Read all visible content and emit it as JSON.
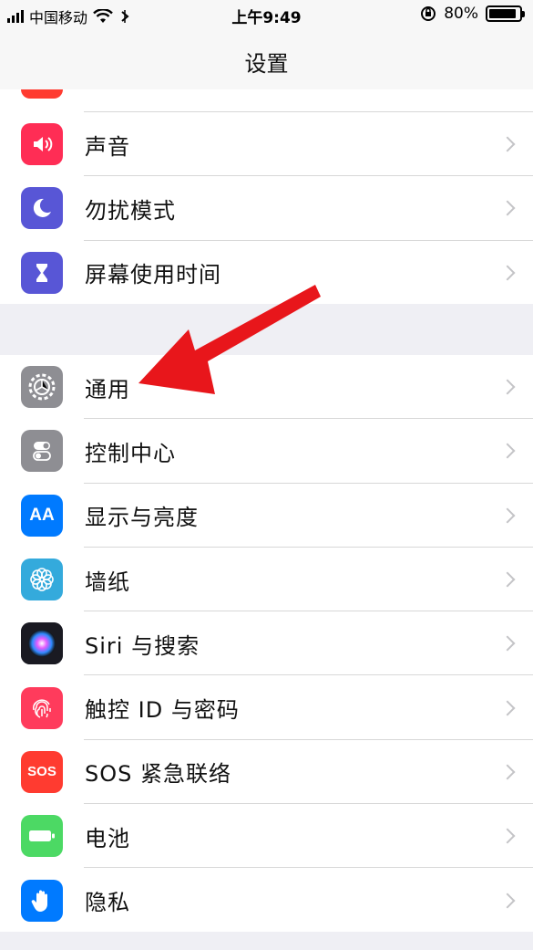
{
  "status_bar": {
    "carrier": "中国移动",
    "time": "上午9:49",
    "battery": "80%",
    "battery_level": 0.8
  },
  "nav": {
    "title": "设置"
  },
  "group1": [
    {
      "label": "声音",
      "icon": "speaker-icon",
      "color": "#ff2d55"
    },
    {
      "label": "勿扰模式",
      "icon": "moon-icon",
      "color": "#5856d6"
    },
    {
      "label": "屏幕使用时间",
      "icon": "hourglass-icon",
      "color": "#5856d6"
    }
  ],
  "group2": [
    {
      "label": "通用",
      "icon": "gear-icon",
      "color": "#8e8e93"
    },
    {
      "label": "控制中心",
      "icon": "toggles-icon",
      "color": "#8e8e93"
    },
    {
      "label": "显示与亮度",
      "icon": "text-size-icon",
      "color": "#007aff",
      "icon_text": "AA"
    },
    {
      "label": "墙纸",
      "icon": "flower-icon",
      "color": "#34aadc"
    },
    {
      "label": "Siri 与搜索",
      "icon": "siri-icon",
      "color": "#222233"
    },
    {
      "label": "触控 ID 与密码",
      "icon": "fingerprint-icon",
      "color": "#ff3b5c"
    },
    {
      "label": "SOS 紧急联络",
      "icon": "sos-icon",
      "color": "#ff3b30",
      "icon_text": "SOS"
    },
    {
      "label": "电池",
      "icon": "battery-icon",
      "color": "#4cd964"
    },
    {
      "label": "隐私",
      "icon": "hand-icon",
      "color": "#007aff"
    }
  ],
  "colors": {
    "arrow": "#e8161b",
    "background": "#efeff4"
  }
}
